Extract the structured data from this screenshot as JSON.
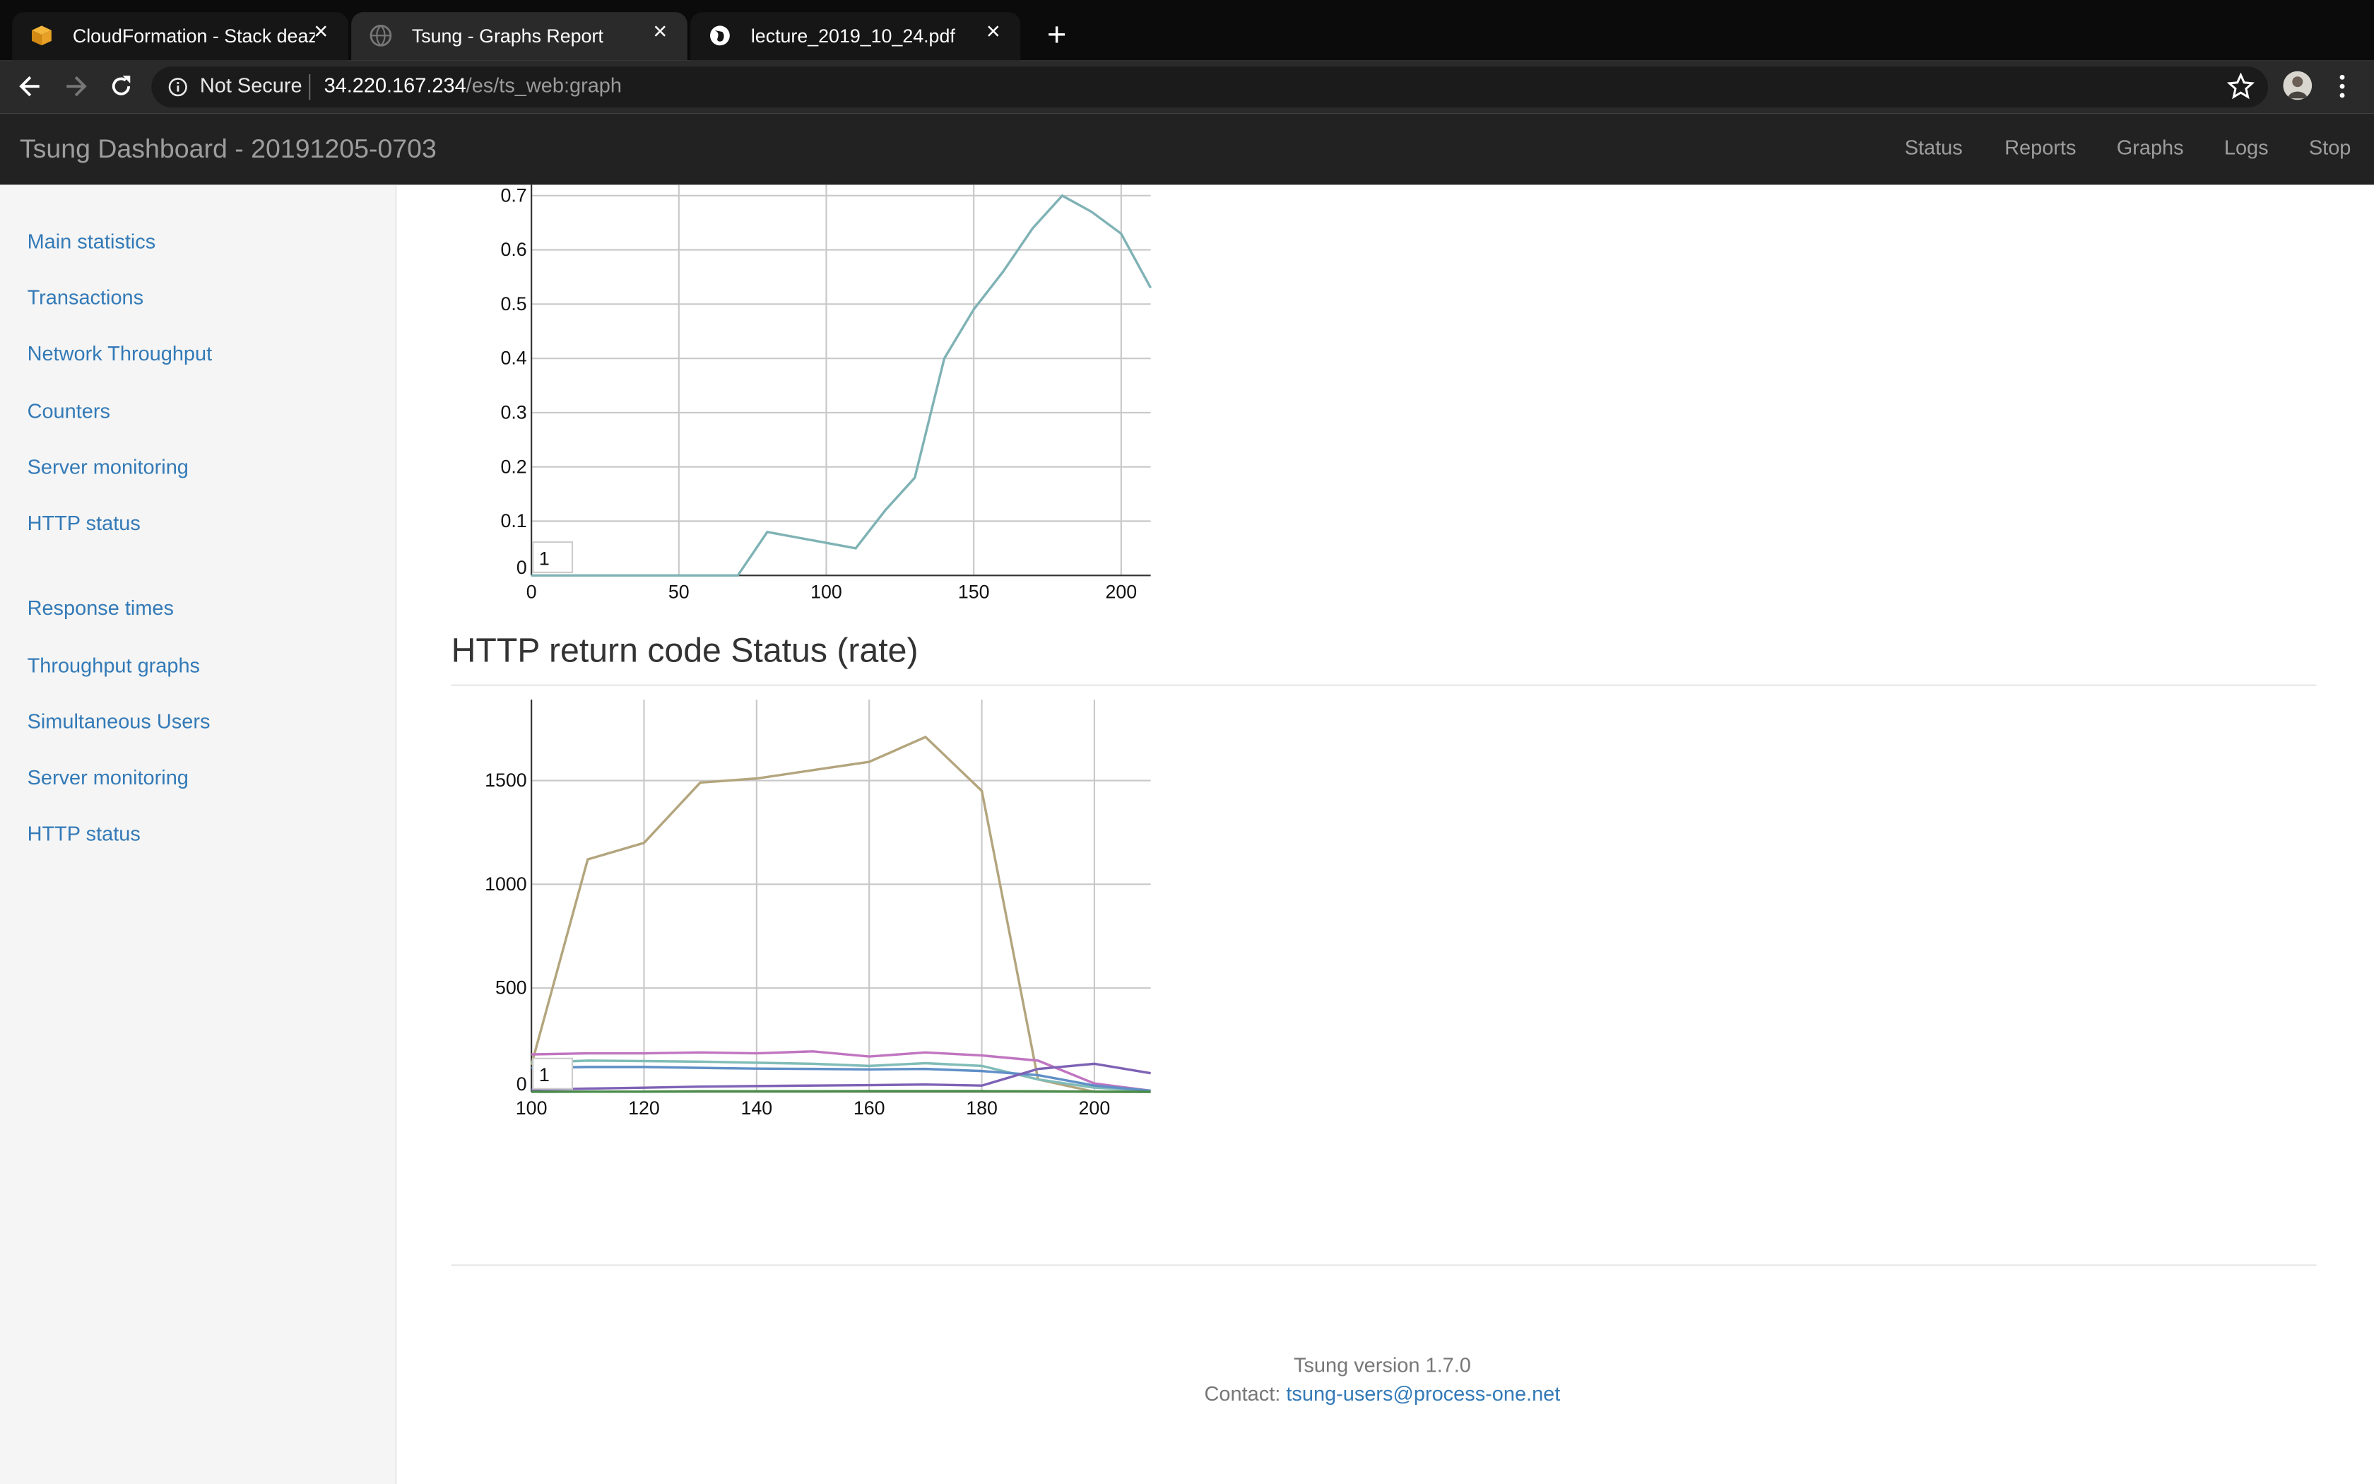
{
  "browser": {
    "tabs": [
      {
        "title": "CloudFormation - Stack deazySt",
        "active": false,
        "icon": "aws-box-icon"
      },
      {
        "title": "Tsung - Graphs Report",
        "active": true,
        "icon": "globe-icon"
      },
      {
        "title": "lecture_2019_10_24.pdf",
        "active": false,
        "icon": "globe-icon"
      }
    ],
    "security_label": "Not Secure",
    "url_host": "34.220.167.234",
    "url_path": "/es/ts_web:graph"
  },
  "app": {
    "brand": "Tsung Dashboard - 20191205-0703",
    "nav": [
      "Status",
      "Reports",
      "Graphs",
      "Logs",
      "Stop"
    ]
  },
  "sidebar": {
    "group1": [
      "Main statistics",
      "Transactions",
      "Network Throughput",
      "Counters",
      "Server monitoring",
      "HTTP status"
    ],
    "group2": [
      "Response times",
      "Throughput graphs",
      "Simultaneous Users",
      "Server monitoring",
      "HTTP status"
    ]
  },
  "section_title": "HTTP return code Status (rate)",
  "footer": {
    "version": "Tsung version 1.7.0",
    "contact_label": "Contact:",
    "contact_email": "tsung-users@process-one.net"
  },
  "chart_data": [
    {
      "type": "line",
      "title": "",
      "xlim": [
        0,
        210
      ],
      "ylim": [
        0,
        0.72
      ],
      "xticks": [
        0,
        50,
        100,
        150,
        200
      ],
      "yticks": [
        0,
        0.1,
        0.2,
        0.3,
        0.4,
        0.5,
        0.6,
        0.7
      ],
      "ytick_labels": [
        "0",
        "0.1",
        "0.2",
        "0.3",
        "0.4",
        "0.5",
        "0.6",
        "0.7"
      ],
      "grid": true,
      "legend": [
        "1"
      ],
      "series": [
        {
          "color": "#7fb2b5",
          "x": [
            0,
            10,
            20,
            30,
            40,
            50,
            60,
            70,
            80,
            90,
            100,
            110,
            120,
            130,
            140,
            150,
            160,
            170,
            180,
            190,
            200,
            210
          ],
          "y": [
            0,
            0,
            0,
            0,
            0,
            0,
            0,
            0,
            0.08,
            0.07,
            0.06,
            0.05,
            0.12,
            0.18,
            0.4,
            0.49,
            0.56,
            0.64,
            0.7,
            0.67,
            0.63,
            0.53
          ]
        }
      ]
    },
    {
      "type": "line",
      "title": "",
      "xlim": [
        100,
        210
      ],
      "ylim": [
        0,
        1890
      ],
      "xticks": [
        100,
        120,
        140,
        160,
        180,
        200
      ],
      "yticks": [
        0,
        500,
        1000,
        1500
      ],
      "ytick_labels": [
        "0",
        "500",
        "1000",
        "1500"
      ],
      "grid": true,
      "legend": [
        "1"
      ],
      "series": [
        {
          "color": "#b3a57d",
          "x": [
            100,
            110,
            120,
            130,
            140,
            150,
            160,
            170,
            180,
            190,
            200,
            210
          ],
          "y": [
            130,
            1120,
            1200,
            1490,
            1510,
            1550,
            1590,
            1710,
            1450,
            60,
            0,
            0
          ]
        },
        {
          "color": "#c075c0",
          "x": [
            100,
            110,
            120,
            130,
            140,
            150,
            160,
            170,
            180,
            190,
            200,
            210
          ],
          "y": [
            180,
            185,
            185,
            190,
            185,
            195,
            170,
            190,
            175,
            150,
            40,
            5
          ]
        },
        {
          "color": "#80bcb8",
          "x": [
            100,
            110,
            120,
            130,
            140,
            150,
            160,
            170,
            180,
            190,
            200,
            210
          ],
          "y": [
            140,
            150,
            148,
            145,
            140,
            135,
            125,
            138,
            125,
            60,
            20,
            5
          ]
        },
        {
          "color": "#5f8fc7",
          "x": [
            100,
            110,
            120,
            130,
            140,
            150,
            160,
            170,
            180,
            190,
            200,
            210
          ],
          "y": [
            115,
            120,
            120,
            115,
            112,
            110,
            108,
            110,
            100,
            80,
            30,
            5
          ]
        },
        {
          "color": "#7e62b5",
          "x": [
            100,
            110,
            120,
            130,
            140,
            150,
            160,
            170,
            180,
            190,
            200,
            210
          ],
          "y": [
            10,
            15,
            20,
            25,
            28,
            30,
            32,
            35,
            30,
            110,
            135,
            90
          ]
        },
        {
          "color": "#4a8b4a",
          "x": [
            100,
            110,
            120,
            130,
            140,
            150,
            160,
            170,
            180,
            190,
            200,
            210
          ],
          "y": [
            0,
            1,
            1,
            2,
            2,
            2,
            3,
            3,
            3,
            2,
            1,
            0
          ]
        }
      ]
    }
  ]
}
